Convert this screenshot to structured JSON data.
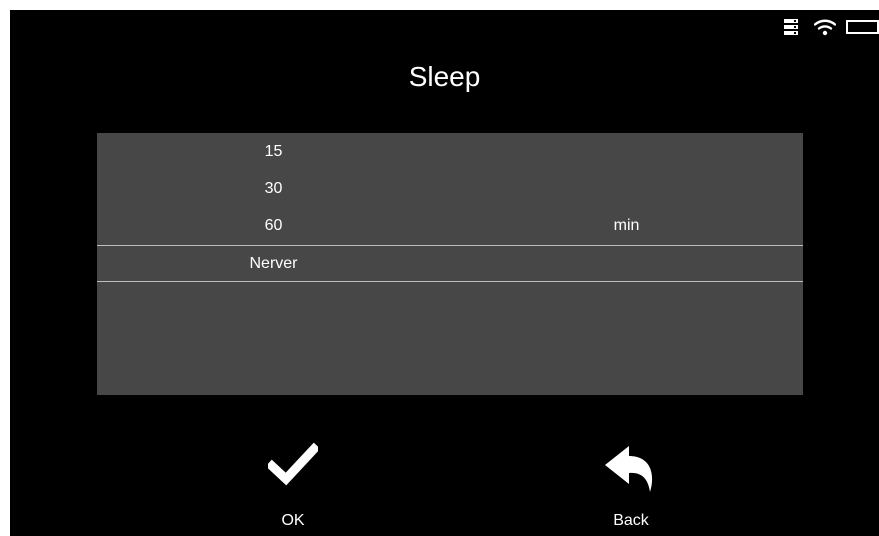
{
  "screen": {
    "title": "Sleep"
  },
  "status_bar": {
    "icons": [
      "storage-icon",
      "wifi-icon",
      "battery-icon"
    ]
  },
  "picker": {
    "values": [
      "15",
      "30",
      "60",
      "Nerver"
    ],
    "selected_value": "Nerver",
    "unit": "min"
  },
  "actions": {
    "ok_label": "OK",
    "back_label": "Back"
  },
  "colors": {
    "background": "#000000",
    "picker_background": "#474747",
    "text": "#ffffff",
    "selection_line": "#bdbdbd"
  }
}
